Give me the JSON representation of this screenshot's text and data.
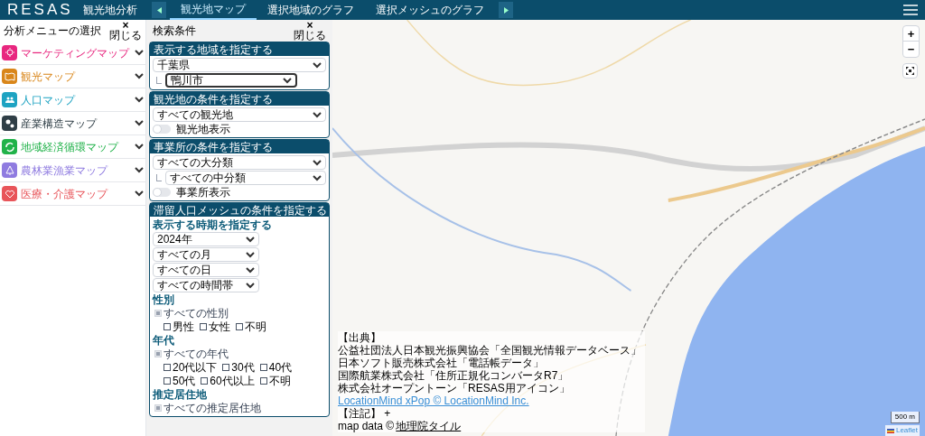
{
  "header": {
    "logo": "RESAS",
    "tabs": [
      {
        "label": "観光地分析",
        "selected": false
      },
      {
        "label": "観光地マップ",
        "selected": true
      },
      {
        "label": "選択地域のグラフ",
        "selected": false
      },
      {
        "label": "選択メッシュのグラフ",
        "selected": false
      }
    ]
  },
  "menu_panel": {
    "title": "分析メニューの選択",
    "close_icon": "×",
    "close": "閉じる",
    "items": [
      {
        "label": "マーケティングマップ",
        "color": "#e8277f",
        "kind": "bulb"
      },
      {
        "label": "観光マップ",
        "color": "#d9861a",
        "kind": "map"
      },
      {
        "label": "人口マップ",
        "color": "#1ea3c2",
        "kind": "people"
      },
      {
        "label": "産業構造マップ",
        "color": "#2f3e46",
        "kind": "gears"
      },
      {
        "label": "地域経済循環マップ",
        "color": "#21b24a",
        "kind": "cycle"
      },
      {
        "label": "農林業漁業マップ",
        "color": "#8f7be0",
        "kind": "tree"
      },
      {
        "label": "医療・介護マップ",
        "color": "#e8555a",
        "kind": "heart"
      }
    ]
  },
  "search_panel": {
    "title": "検索条件",
    "close_icon": "×",
    "close": "閉じる",
    "sections": [
      {
        "title": "表示する地域を指定する",
        "rows": [
          {
            "kind": "select",
            "value": "千葉県",
            "sub": false,
            "focused": false
          },
          {
            "kind": "select",
            "value": "鴨川市",
            "sub": true,
            "focused": true
          }
        ]
      },
      {
        "title": "観光地の条件を指定する",
        "rows": [
          {
            "kind": "select",
            "value": "すべての観光地",
            "sub": false,
            "focused": false
          },
          {
            "kind": "toggle",
            "label": "観光地表示",
            "on": false
          }
        ]
      },
      {
        "title": "事業所の条件を指定する",
        "rows": [
          {
            "kind": "select",
            "value": "すべての大分類",
            "sub": false,
            "focused": false
          },
          {
            "kind": "select",
            "value": "すべての中分類",
            "sub": true,
            "focused": false
          },
          {
            "kind": "toggle",
            "label": "事業所表示",
            "on": false
          }
        ]
      },
      {
        "title": "滞留人口メッシュの条件を指定する",
        "rows": [
          {
            "kind": "heading",
            "label": "表示する時期を指定する"
          },
          {
            "kind": "small-select",
            "value": "2024年"
          },
          {
            "kind": "small-select",
            "value": "すべての月"
          },
          {
            "kind": "small-select",
            "value": "すべての日"
          },
          {
            "kind": "small-select",
            "value": "すべての時間帯"
          },
          {
            "kind": "heading",
            "label": "性別"
          },
          {
            "kind": "checks",
            "indent": false,
            "items": [
              {
                "label": "すべての性別",
                "checked": true,
                "disabled": true
              }
            ]
          },
          {
            "kind": "checks",
            "indent": true,
            "items": [
              {
                "label": "男性",
                "checked": false,
                "disabled": false
              },
              {
                "label": "女性",
                "checked": false,
                "disabled": false
              },
              {
                "label": "不明",
                "checked": false,
                "disabled": false
              }
            ]
          },
          {
            "kind": "heading",
            "label": "年代"
          },
          {
            "kind": "checks",
            "indent": false,
            "items": [
              {
                "label": "すべての年代",
                "checked": true,
                "disabled": true
              }
            ]
          },
          {
            "kind": "checks",
            "indent": true,
            "items": [
              {
                "label": "20代以下",
                "checked": false,
                "disabled": false
              },
              {
                "label": "30代",
                "checked": false,
                "disabled": false
              },
              {
                "label": "40代",
                "checked": false,
                "disabled": false
              }
            ]
          },
          {
            "kind": "checks",
            "indent": true,
            "items": [
              {
                "label": "50代",
                "checked": false,
                "disabled": false
              },
              {
                "label": "60代以上",
                "checked": false,
                "disabled": false
              },
              {
                "label": "不明",
                "checked": false,
                "disabled": false
              }
            ]
          },
          {
            "kind": "heading",
            "label": "推定居住地"
          },
          {
            "kind": "checks",
            "indent": false,
            "items": [
              {
                "label": "すべての推定居住地",
                "checked": true,
                "disabled": true
              }
            ]
          }
        ]
      }
    ]
  },
  "map": {
    "zoom_in": "+",
    "zoom_out": "−",
    "attribution": [
      {
        "kind": "text",
        "text": "【出典】"
      },
      {
        "kind": "text",
        "text": "公益社団法人日本観光振興協会「全国観光情報データベース」"
      },
      {
        "kind": "text",
        "text": "日本ソフト販売株式会社「電話帳データ」"
      },
      {
        "kind": "text",
        "text": "国際航業株式会社「住所正規化コンバータR7」"
      },
      {
        "kind": "text",
        "text": "株式会社オープントーン「RESAS用アイコン」"
      },
      {
        "kind": "link",
        "text": "LocationMind xPop © LocationMind Inc."
      },
      {
        "kind": "text",
        "text": "【注記】 +"
      },
      {
        "kind": "mixed",
        "text": "map data ©",
        "link": "地理院タイル"
      }
    ],
    "scale": "500 m",
    "leaflet": "Leaflet"
  }
}
